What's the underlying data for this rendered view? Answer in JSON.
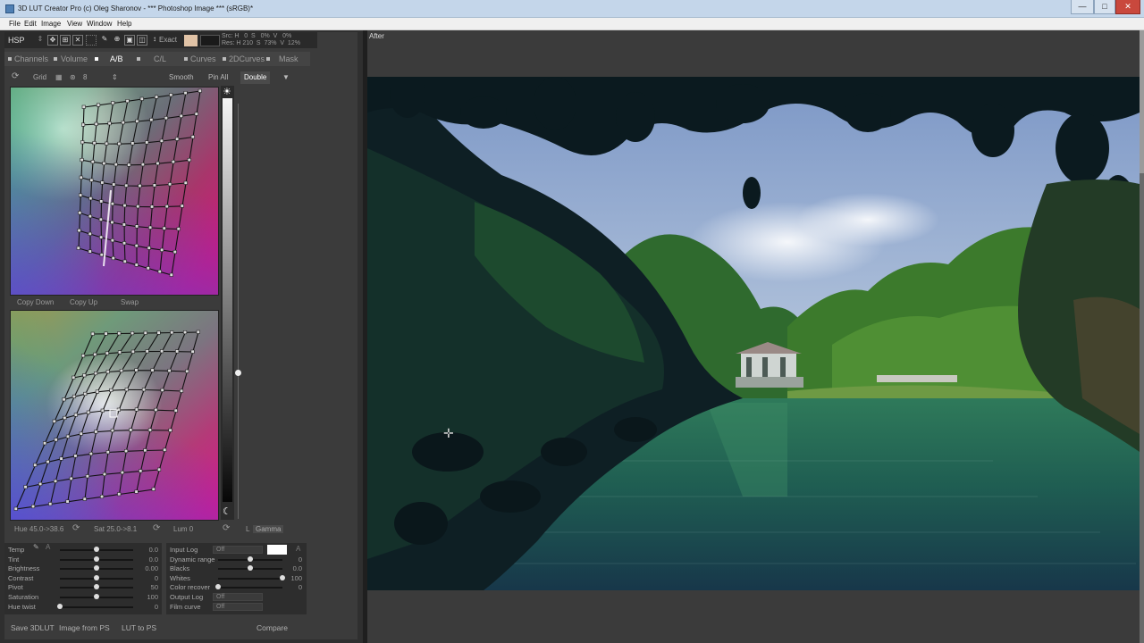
{
  "window": {
    "title": "3D LUT Creator Pro (c) Oleg Sharonov - *** Photoshop Image *** (sRGB)*",
    "buttons": {
      "minimize": "—",
      "maximize": "□",
      "close": "✕"
    }
  },
  "menu": [
    "File",
    "Edit",
    "Image",
    "View",
    "Window",
    "Help"
  ],
  "toolbar": {
    "mode": "HSP",
    "exact_label": "Exact",
    "src_readout": "Src: H   0  S   0%  V   0%",
    "res_readout": "Res: H 210  S  73%  V  12%",
    "swatch_color": "#e1c3a6"
  },
  "tabs": [
    {
      "label": "Channels",
      "active": false
    },
    {
      "label": "Volume",
      "active": false
    },
    {
      "label": "A/B",
      "active": true
    },
    {
      "label": "C/L",
      "active": false
    },
    {
      "label": "Curves",
      "active": false
    },
    {
      "label": "2DCurves",
      "active": false
    },
    {
      "label": "Mask",
      "active": false
    }
  ],
  "grid_row": {
    "grid_label": "Grid",
    "grid_size": "8",
    "smooth": "Smooth",
    "pin_all": "Pin All",
    "double": "Double"
  },
  "copy_row": {
    "copy_down": "Copy Down",
    "copy_up": "Copy Up",
    "swap": "Swap"
  },
  "hs_row": {
    "hue": "Hue 45.0->38.6",
    "sat": "Sat 25.0->8.1",
    "lum": "Lum  0",
    "lmode": "L",
    "gamma": "Gamma"
  },
  "adjust_left": [
    {
      "label": "Temp",
      "value": "0.0",
      "pos": 0.5
    },
    {
      "label": "Tint",
      "value": "0.0",
      "pos": 0.5
    },
    {
      "label": "Brightness",
      "value": "0.00",
      "pos": 0.5
    },
    {
      "label": "Contrast",
      "value": "0",
      "pos": 0.5
    },
    {
      "label": "Pivot",
      "value": "50",
      "pos": 0.5
    },
    {
      "label": "Saturation",
      "value": "100",
      "pos": 0.5
    },
    {
      "label": "Hue twist",
      "value": "0",
      "pos": 0.0
    }
  ],
  "adjust_right": [
    {
      "label": "Input Log",
      "type": "dropdown",
      "value": "Off"
    },
    {
      "label": "Dynamic range",
      "type": "slider",
      "value": "0",
      "pos": 0.5
    },
    {
      "label": "Blacks",
      "type": "slider",
      "value": "0.0",
      "pos": 0.5
    },
    {
      "label": "Whites",
      "type": "slider",
      "value": "100",
      "pos": 1.0
    },
    {
      "label": "Color recover",
      "type": "slider",
      "value": "0",
      "pos": 0.0
    },
    {
      "label": "Output Log",
      "type": "dropdown",
      "value": "Off"
    },
    {
      "label": "Film curve",
      "type": "dropdown",
      "value": "Off"
    }
  ],
  "adjust_right_extra": {
    "a_label": "A"
  },
  "adjust_left_extra": {
    "a_label": "A"
  },
  "bottom_row": {
    "save": "Save 3DLUT",
    "image_from_ps": "Image from PS",
    "lut_to_ps": "LUT to PS",
    "compare": "Compare"
  },
  "viewer": {
    "label": "After"
  }
}
